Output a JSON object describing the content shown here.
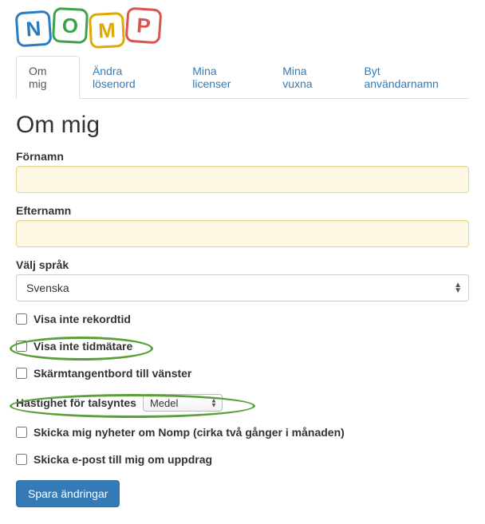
{
  "logo": {
    "letters": [
      "N",
      "O",
      "M",
      "P"
    ]
  },
  "tabs": [
    {
      "label": "Om mig",
      "active": true
    },
    {
      "label": "Ändra lösenord",
      "active": false
    },
    {
      "label": "Mina licenser",
      "active": false
    },
    {
      "label": "Mina vuxna",
      "active": false
    },
    {
      "label": "Byt användarnamn",
      "active": false
    }
  ],
  "page": {
    "title": "Om mig"
  },
  "form": {
    "firstname_label": "Förnamn",
    "firstname_value": "",
    "lastname_label": "Efternamn",
    "lastname_value": "",
    "language_label": "Välj språk",
    "language_value": "Svenska",
    "cb_hide_record": "Visa inte rekordtid",
    "cb_hide_timer": "Visa inte tidmätare",
    "cb_keyboard_left": "Skärmtangentbord till vänster",
    "tts_label": "Hastighet för talsyntes",
    "tts_value": "Medel",
    "cb_newsletter": "Skicka mig nyheter om Nomp (cirka två gånger i månaden)",
    "cb_email_assign": "Skicka e-post till mig om uppdrag",
    "submit": "Spara ändringar"
  }
}
